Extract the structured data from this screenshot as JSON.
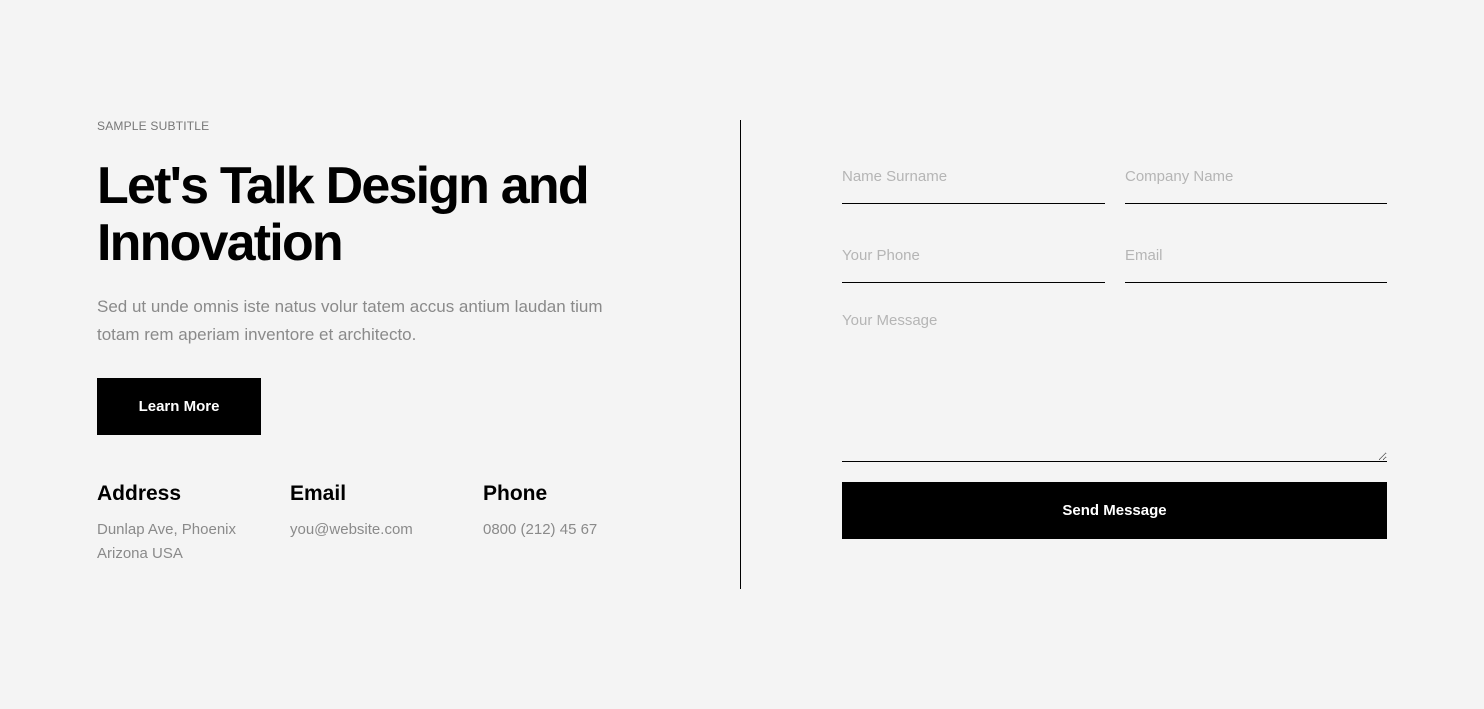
{
  "hero": {
    "subtitle": "SAMPLE SUBTITLE",
    "title": "Let's Talk Design and Innovation",
    "description": "Sed ut unde omnis iste natus volur tatem accus antium laudan tium totam rem aperiam inventore et architecto.",
    "button_label": "Learn More"
  },
  "contact_info": {
    "address": {
      "title": "Address",
      "lines": [
        "Dunlap Ave, Phoenix",
        "Arizona USA"
      ]
    },
    "email": {
      "title": "Email",
      "value": "you@website.com"
    },
    "phone": {
      "title": "Phone",
      "value": "0800 (212) 45 67"
    }
  },
  "form": {
    "name_placeholder": "Name Surname",
    "company_placeholder": "Company Name",
    "phone_placeholder": "Your Phone",
    "email_placeholder": "Email",
    "message_placeholder": "Your Message",
    "submit_label": "Send Message"
  },
  "colors": {
    "background": "#f4f4f4",
    "primary": "#000000",
    "muted_text": "#8a8a8a",
    "placeholder": "#b5b5b5"
  }
}
